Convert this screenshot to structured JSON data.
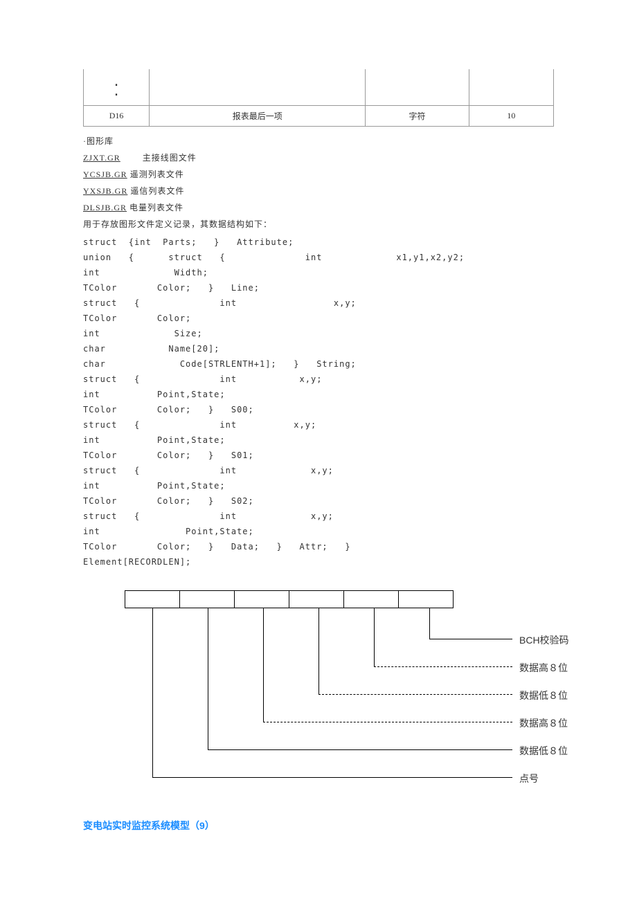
{
  "table": {
    "dots": ".",
    "row": {
      "c1": "D16",
      "c2": "报表最后一项",
      "c3": "字符",
      "c4": "10"
    }
  },
  "text": {
    "bullet": "·图形库",
    "file_zjxt": "ZJXT.GR",
    "file_zjxt_desc": "主接线图文件",
    "file_ycsjb": "YCSJB.GR",
    "file_ycsjb_desc": "遥测列表文件",
    "file_yxsjb": "YXSJB.GR",
    "file_yxsjb_desc": "遥信列表文件",
    "file_dlsjb": "DLSJB.GR",
    "file_dlsjb_desc": "电量列表文件",
    "desc_store": "用于存放图形文件定义记录，其数据结构如下："
  },
  "code": "struct  {int  Parts;   }   Attribute;\nunion   {      struct   {              int             x1,y1,x2,y2;\nint             Width;\nTColor       Color;   }   Line;\nstruct   {              int                 x,y;\nTColor       Color;\nint             Size;\nchar           Name[20];\nchar             Code[STRLENTH+1];   }   String;\nstruct   {              int           x,y;\nint          Point,State;\nTColor       Color;   }   S00;\nstruct   {              int          x,y;\nint          Point,State;\nTColor       Color;   }   S01;\nstruct   {              int             x,y;\nint          Point,State;\nTColor       Color;   }   S02;\nstruct   {              int             x,y;\nint               Point,State;\nTColor       Color;   }   Data;   }   Attr;   }\nElement[RECORDLEN];",
  "diagram": {
    "labels": {
      "bch": "BCH校验码",
      "high8_1": "数据高８位",
      "low8_1": "数据低８位",
      "high8_2": "数据高８位",
      "low8_2": "数据低８位",
      "pointno": "点号"
    }
  },
  "footer": "变电站实时监控系统模型（9）"
}
